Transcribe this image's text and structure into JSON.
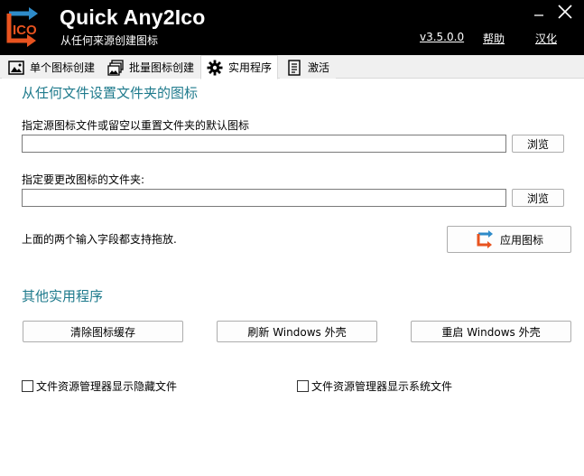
{
  "app": {
    "title": "Quick Any2Ico",
    "subtitle": "从任何来源创建图标",
    "version": "v3.5.0.0",
    "help": "帮助",
    "localize": "汉化",
    "logo_text": "ICO"
  },
  "tabs": [
    {
      "label": "单个图标创建",
      "icon": "single-image-icon"
    },
    {
      "label": "批量图标创建",
      "icon": "batch-images-icon"
    },
    {
      "label": "实用程序",
      "icon": "gear-icon",
      "active": true
    },
    {
      "label": "激活",
      "icon": "license-icon"
    }
  ],
  "folder_icon": {
    "title": "从任何文件设置文件夹的图标",
    "source_label": "指定源图标文件或留空以重置文件夹的默认图标",
    "source_value": "",
    "browse": "浏览",
    "target_label": "指定要更改图标的文件夹:",
    "target_value": "",
    "drag_note": "上面的两个输入字段都支持拖放.",
    "apply": "应用图标"
  },
  "other": {
    "title": "其他实用程序",
    "clear_cache": "清除图标缓存",
    "refresh_shell": "刷新 Windows 外壳",
    "restart_shell": "重启 Windows 外壳",
    "show_hidden": "文件资源管理器显示隐藏文件",
    "show_system": "文件资源管理器显示系统文件"
  },
  "colors": {
    "header_bg": "#000000",
    "section_title": "#1e7a8c",
    "logo_accent": "#e8531f",
    "logo_arrow": "#2e8bc9"
  }
}
